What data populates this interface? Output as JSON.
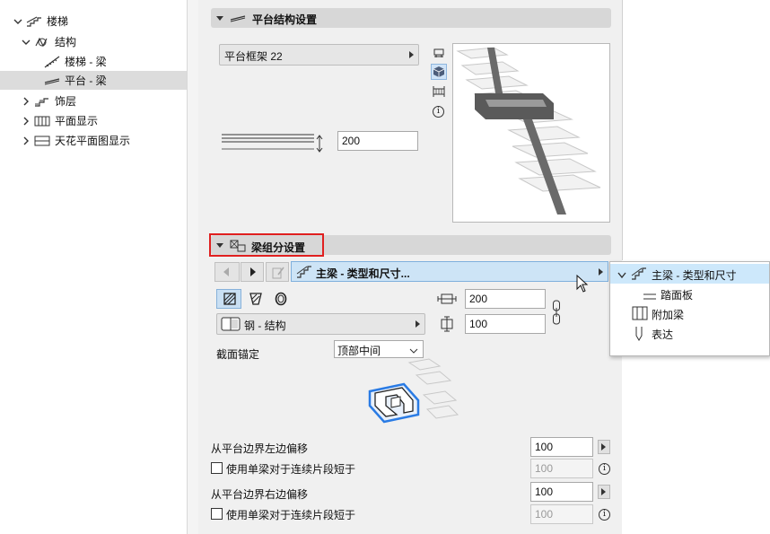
{
  "tree": {
    "items": [
      {
        "label": "楼梯",
        "expanded": true,
        "level": 0
      },
      {
        "label": "结构",
        "expanded": true,
        "level": 1
      },
      {
        "label": "楼梯 - 梁",
        "level": 2
      },
      {
        "label": "平台 - 梁",
        "level": 2,
        "selected": true
      },
      {
        "label": "饰层",
        "expanded": false,
        "level": 1
      },
      {
        "label": "平面显示",
        "expanded": false,
        "level": 1
      },
      {
        "label": "天花平面图显示",
        "expanded": false,
        "level": 1
      }
    ]
  },
  "platform_section": {
    "title": "平台结构设置",
    "frame_combo": "平台框架 22",
    "thickness": "200"
  },
  "beam_section": {
    "title": "梁组分设置",
    "component_combo": "主梁 - 类型和尺寸...",
    "width": "200",
    "height": "100",
    "material": "钢 - 结构",
    "anchor_label": "截面锚定",
    "anchor_value": "顶部中间",
    "left_offset_label": "从平台边界左边偏移",
    "left_offset_value": "100",
    "left_single_label": "使用单梁对于连续片段短于",
    "left_single_value": "100",
    "right_offset_label": "从平台边界右边偏移",
    "right_offset_value": "100",
    "right_single_label": "使用单梁对于连续片段短于",
    "right_single_value": "100"
  },
  "popup": {
    "items": [
      {
        "label": "主梁 - 类型和尺寸",
        "selected": true
      },
      {
        "label": "踏面板"
      },
      {
        "label": "附加梁"
      },
      {
        "label": "表达"
      }
    ]
  },
  "colors": {
    "highlight_red": "#e02020",
    "selection_blue": "#cde8fb",
    "accent_blue": "#2a7be4"
  }
}
